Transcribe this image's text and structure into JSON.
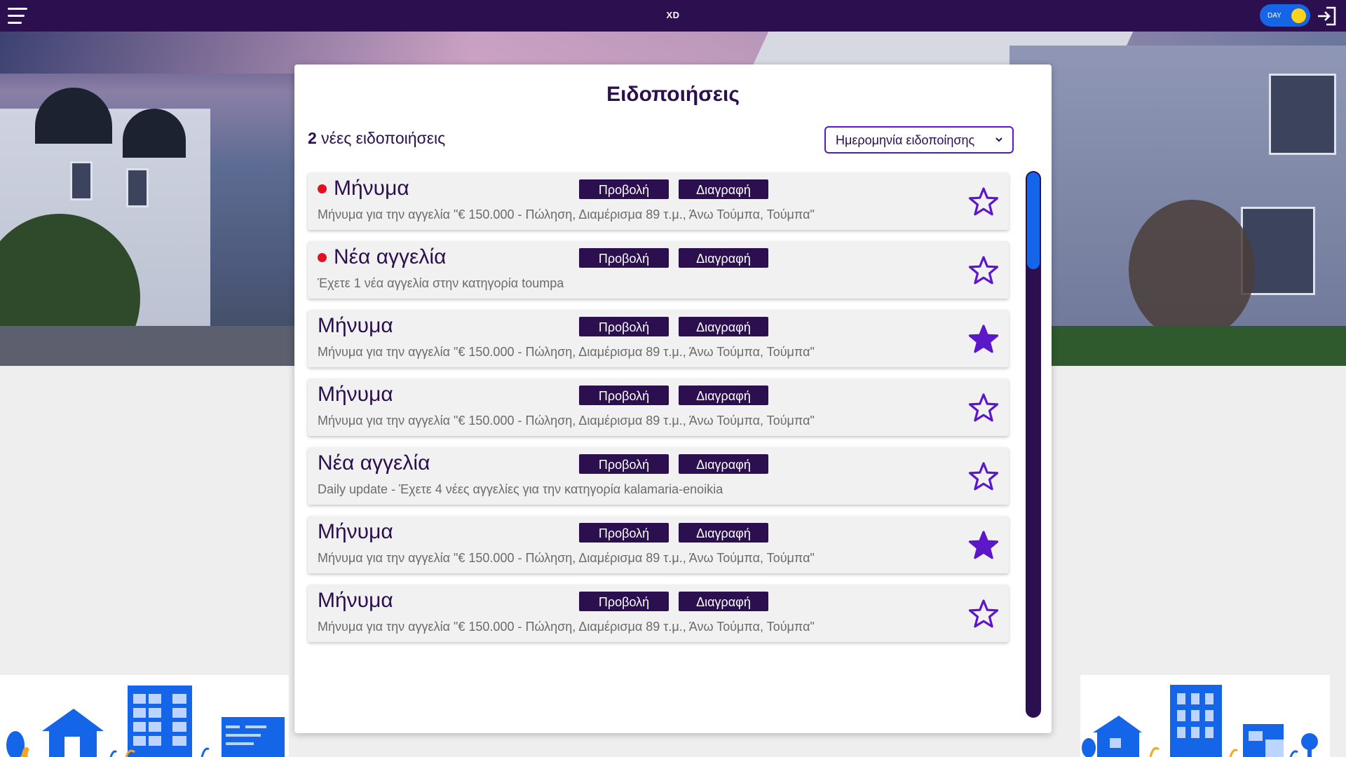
{
  "header": {
    "brand": "XD",
    "theme_toggle_label": "DAY",
    "accent": "#2b0f4f",
    "toggle_color": "#1565e8",
    "toggle_knob_color": "#ffd21f",
    "icons": [
      "menu-icon",
      "login-icon"
    ]
  },
  "page": {
    "title": "Ειδοποιήσεις",
    "new_count": "2",
    "new_count_suffix": " νέες ειδοποιήσεις",
    "sort_selected": "Ημερομηνία ειδοποίησης"
  },
  "notifications": [
    {
      "title": "Μήνυμα",
      "text": "Μήνυμα για την αγγελία \"€ 150.000 - Πώληση, Διαμέρισμα 89 τ.μ., Άνω Τούμπα, Τούμπα\"",
      "unread": true,
      "starred": false,
      "view_label": "Προβολή",
      "delete_label": "Διαγραφή"
    },
    {
      "title": "Νέα αγγελία",
      "text": "Έχετε 1 νέα αγγελία στην κατηγορία toumpa",
      "unread": true,
      "starred": false,
      "view_label": "Προβολή",
      "delete_label": "Διαγραφή"
    },
    {
      "title": "Μήνυμα",
      "text": "Μήνυμα για την αγγελία \"€ 150.000 - Πώληση, Διαμέρισμα 89 τ.μ., Άνω Τούμπα, Τούμπα\"",
      "unread": false,
      "starred": true,
      "view_label": "Προβολή",
      "delete_label": "Διαγραφή"
    },
    {
      "title": "Μήνυμα",
      "text": "Μήνυμα για την αγγελία \"€ 150.000 - Πώληση, Διαμέρισμα 89 τ.μ., Άνω Τούμπα, Τούμπα\"",
      "unread": false,
      "starred": false,
      "view_label": "Προβολή",
      "delete_label": "Διαγραφή"
    },
    {
      "title": "Νέα αγγελία",
      "text": "Daily update - Έχετε 4 νέες αγγελίες για την κατηγορία kalamaria-enoikia",
      "unread": false,
      "starred": false,
      "view_label": "Προβολή",
      "delete_label": "Διαγραφή"
    },
    {
      "title": "Μήνυμα",
      "text": "Μήνυμα για την αγγελία \"€ 150.000 - Πώληση, Διαμέρισμα 89 τ.μ., Άνω Τούμπα, Τούμπα\"",
      "unread": false,
      "starred": true,
      "view_label": "Προβολή",
      "delete_label": "Διαγραφή"
    },
    {
      "title": "Μήνυμα",
      "text": "Μήνυμα για την αγγελία \"€ 150.000 - Πώληση, Διαμέρισμα 89 τ.μ., Άνω Τούμπα, Τούμπα\"",
      "unread": false,
      "starred": false,
      "view_label": "Προβολή",
      "delete_label": "Διαγραφή"
    }
  ],
  "colors": {
    "star": "#5c17c8",
    "unread_dot": "#e3101f",
    "scroll_thumb": "#1565e8"
  }
}
